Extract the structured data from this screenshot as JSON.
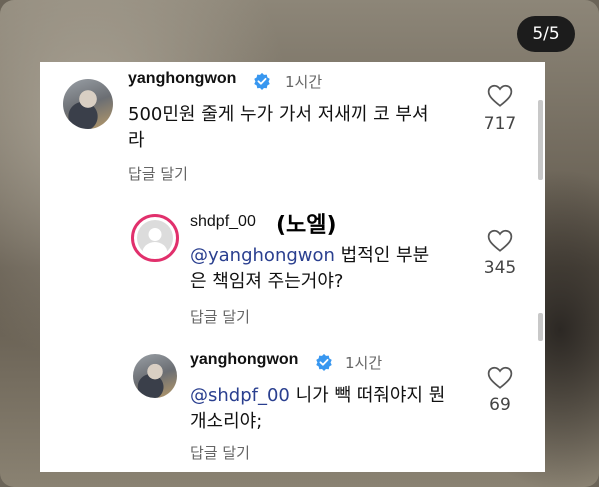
{
  "page_indicator": "5/5",
  "comments": [
    {
      "username": "yanghongwon",
      "verified": true,
      "time": "1시간",
      "text_line1": "500민원 줄게 누가 가서 저새끼 코 부셔",
      "text_line2": "라",
      "reply_label": "답글 달기",
      "likes": "717"
    },
    {
      "username": "shdpf_00",
      "nickname": "(노엘)",
      "mention": "@yanghongwon",
      "text_line1_rest": " 법적인 부분",
      "text_line2": "은 책임져 주는거야?",
      "reply_label": "답글 달기",
      "likes": "345"
    },
    {
      "username": "yanghongwon",
      "verified": true,
      "time": "1시간",
      "mention": "@shdpf_00",
      "text_line1_rest": " 니가 빽 떠줘야지 뭔",
      "text_line2": "개소리야;",
      "reply_label": "답글 달기",
      "likes": "69"
    }
  ],
  "colors": {
    "verified": "#3897f0",
    "mention": "#2a3f8f",
    "story_ring": "#e1306c"
  }
}
